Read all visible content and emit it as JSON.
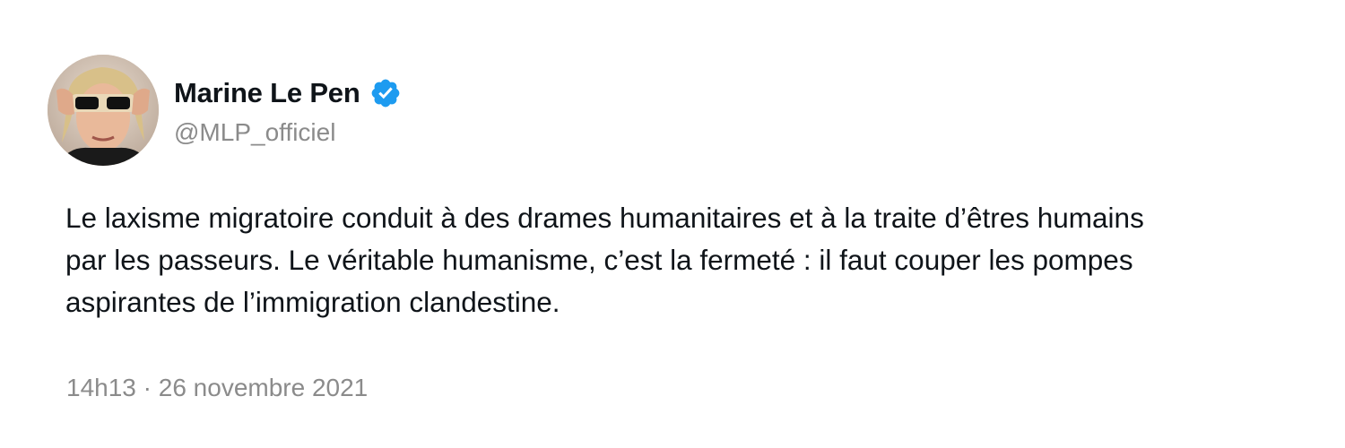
{
  "author": {
    "display_name": "Marine Le Pen",
    "handle": "@MLP_officiel",
    "verified": true,
    "verified_icon": "verified-badge-icon",
    "avatar": "profile-photo"
  },
  "tweet": {
    "text_lines": [
      "Le laxisme migratoire conduit à des drames humanitaires et à la traite d’êtres humains",
      "par les passeurs. Le véritable humanisme, c’est la fermeté : il faut couper les pompes",
      "aspirantes de l’immigration clandestine."
    ],
    "timestamp": "14h13 · 26 novembre 2021"
  },
  "colors": {
    "text_primary": "#0f1419",
    "text_secondary": "#8b8b8b",
    "verified_blue": "#1d9bf0",
    "background": "#ffffff"
  }
}
